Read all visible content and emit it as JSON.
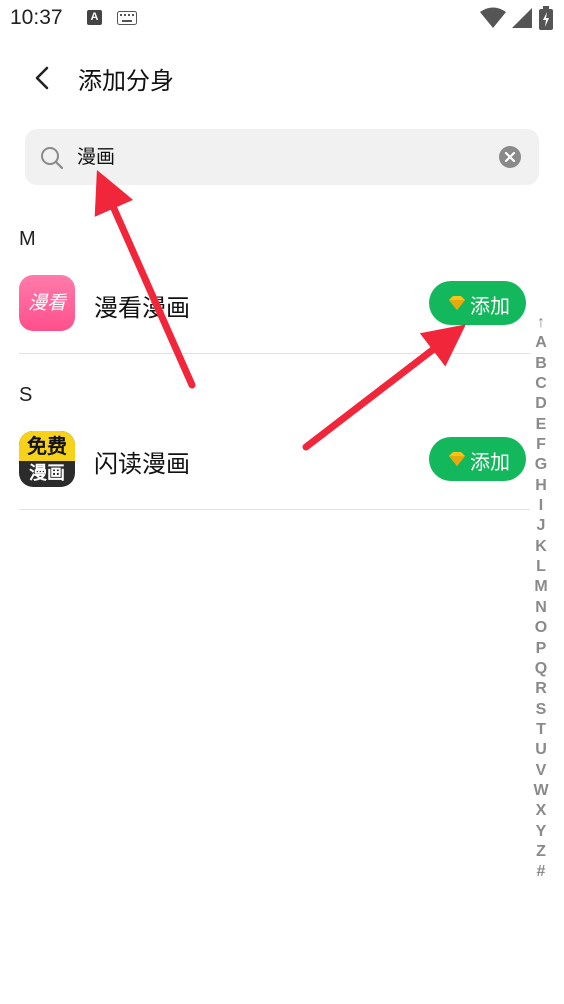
{
  "status_bar": {
    "time": "10:37",
    "notification_icon_letter": "A",
    "icons": [
      "keyboard-icon",
      "wifi-icon",
      "signal-icon",
      "battery-charging-icon"
    ]
  },
  "header": {
    "back_icon": "back-chevron-icon",
    "title": "添加分身"
  },
  "search": {
    "value": "漫画",
    "icons": [
      "search-icon",
      "clear-icon"
    ]
  },
  "sections": [
    {
      "header": "M",
      "apps": [
        {
          "name": "漫看漫画",
          "icon_text": "漫看",
          "add_label": "添加"
        }
      ]
    },
    {
      "header": "S",
      "apps": [
        {
          "name": "闪读漫画",
          "icon_text_top": "免费",
          "icon_text_bottom": "漫画",
          "add_label": "添加"
        }
      ]
    }
  ],
  "alphabet_index": [
    "↑",
    "A",
    "B",
    "C",
    "D",
    "E",
    "F",
    "G",
    "H",
    "I",
    "J",
    "K",
    "L",
    "M",
    "N",
    "O",
    "P",
    "Q",
    "R",
    "S",
    "T",
    "U",
    "V",
    "W",
    "X",
    "Y",
    "Z",
    "#"
  ],
  "colors": {
    "add_button": "#12b85b",
    "annotation_arrow": "#f2263a",
    "search_background": "#f1f1f1"
  }
}
